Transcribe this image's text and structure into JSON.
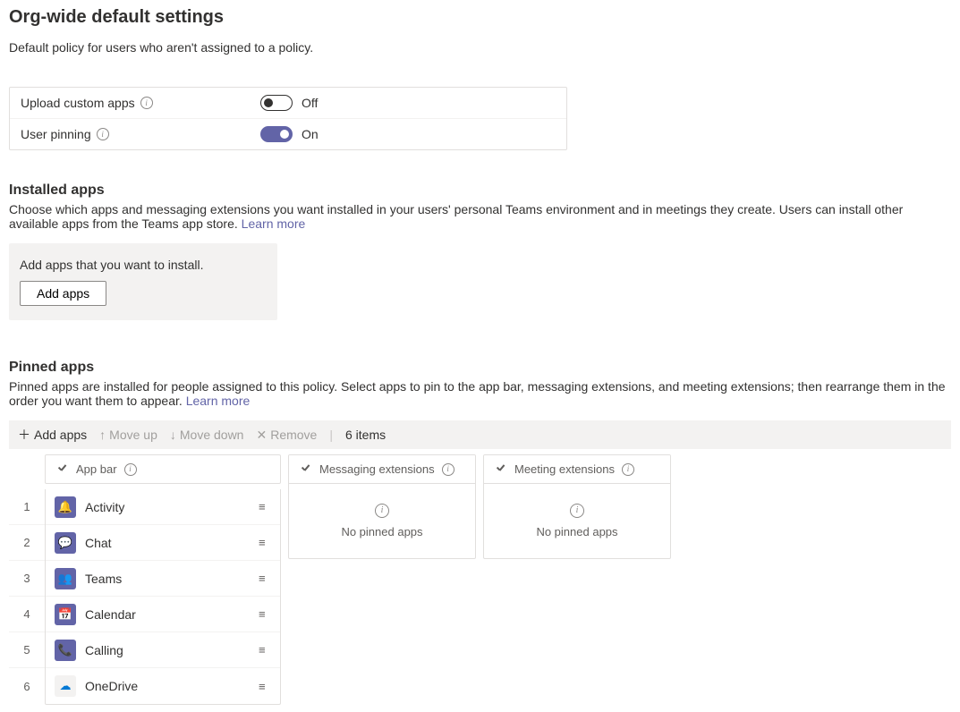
{
  "page": {
    "title": "Org-wide default settings",
    "description": "Default policy for users who aren't assigned to a policy."
  },
  "toggles": {
    "upload_custom_apps": {
      "label": "Upload custom apps",
      "state_label": "Off",
      "on": false
    },
    "user_pinning": {
      "label": "User pinning",
      "state_label": "On",
      "on": true
    }
  },
  "installed": {
    "title": "Installed apps",
    "description": "Choose which apps and messaging extensions you want installed in your users' personal Teams environment and in meetings they create. Users can install other available apps from the Teams app store.",
    "learn_more": "Learn more",
    "box_text": "Add apps that you want to install.",
    "add_button": "Add apps"
  },
  "pinned": {
    "title": "Pinned apps",
    "description": "Pinned apps are installed for people assigned to this policy. Select apps to pin to the app bar, messaging extensions, and meeting extensions; then rearrange them in the order you want them to appear.",
    "learn_more": "Learn more"
  },
  "toolbar": {
    "add_apps": "Add apps",
    "move_up": "Move up",
    "move_down": "Move down",
    "remove": "Remove",
    "count": "6 items"
  },
  "columns": {
    "app_bar": "App bar",
    "messaging": "Messaging extensions",
    "meeting": "Meeting extensions",
    "no_pinned": "No pinned apps"
  },
  "apps": [
    {
      "index": "1",
      "name": "Activity",
      "icon_glyph": "🔔",
      "icon_class": "purple"
    },
    {
      "index": "2",
      "name": "Chat",
      "icon_glyph": "💬",
      "icon_class": "purple"
    },
    {
      "index": "3",
      "name": "Teams",
      "icon_glyph": "👥",
      "icon_class": "purple"
    },
    {
      "index": "4",
      "name": "Calendar",
      "icon_glyph": "📅",
      "icon_class": "purple"
    },
    {
      "index": "5",
      "name": "Calling",
      "icon_glyph": "📞",
      "icon_class": "purple"
    },
    {
      "index": "6",
      "name": "OneDrive",
      "icon_glyph": "☁",
      "icon_class": "light"
    }
  ]
}
